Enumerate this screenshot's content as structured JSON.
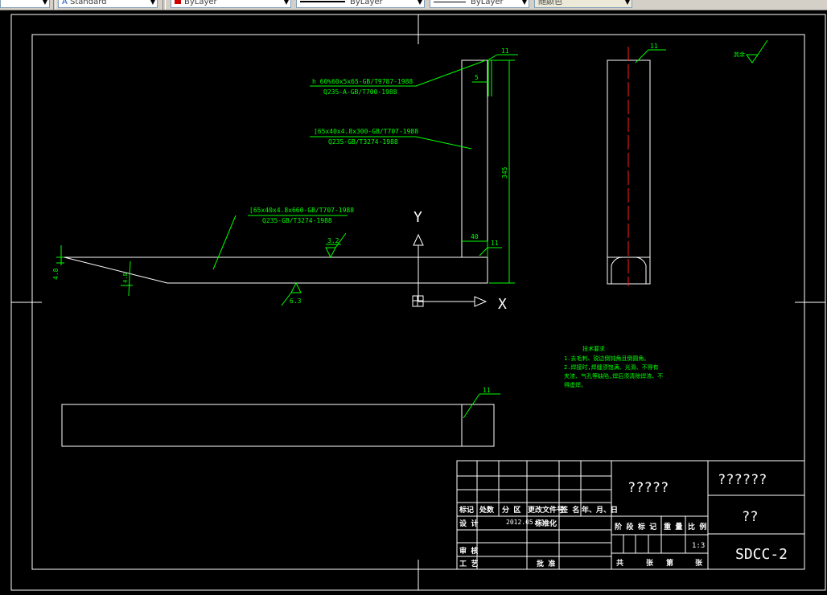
{
  "toolbar": {
    "text_style": "Standard",
    "layer_color": "ByLayer",
    "linetype": "ByLayer",
    "lineweight": "ByLayer",
    "plot_style": "随颜色"
  },
  "annotations": {
    "leader1_line1": "h 60%60x5x65-GB/T9787-1988",
    "leader1_line2": "Q235-A-GB/T700-1988",
    "leader2_line1": "[65x40x4.8x300-GB/T707-1988",
    "leader2_line2": "Q235-GB/T3274-1988",
    "leader3_line1": "[65x40x4.8x660-GB/T707-1988",
    "leader3_line2": "Q235-GB/T3274-1988"
  },
  "dimensions": {
    "weld_top": "11",
    "five": "5",
    "height_345": "345",
    "forty": "40",
    "weld_mid": "11",
    "rough_32": "3.2",
    "left_48": "4.8",
    "left_48b": "4.8",
    "rough_63": "6.3",
    "weld_side": "11",
    "weld_bottom": "11",
    "surface_mark": "其余"
  },
  "ucs": {
    "x": "X",
    "y": "Y"
  },
  "notes": {
    "title": "技术要求",
    "line1": "1.去毛刺、锐边倒钝角且倒圆角。",
    "line2": "2.焊接时,焊缝须饱满、光滑、不得有",
    "line3": "  夹渣、气孔等缺陷,焊后须清除焊渣、不",
    "line4": "  得虚焊。"
  },
  "title_block": {
    "hdr_mark": "标记",
    "hdr_count": "处数",
    "hdr_zone": "分 区",
    "hdr_doc": "更改文件号",
    "hdr_sign": "签 名",
    "hdr_date": "年、月、日",
    "design": "设 计",
    "design_date": "2012.05.11",
    "standardize": "标准化",
    "review": "审 核",
    "process": "工 艺",
    "approve": "批 准",
    "stage": "阶 段 标 记",
    "weight": "重 量",
    "scale": "比 例",
    "scale_value": "1:3",
    "total": "共",
    "sheets": "张",
    "sheet_no": "第",
    "sheet_of": "张",
    "material": "?????",
    "company": "??????",
    "name": "??",
    "drawing_no": "SDCC-2"
  }
}
